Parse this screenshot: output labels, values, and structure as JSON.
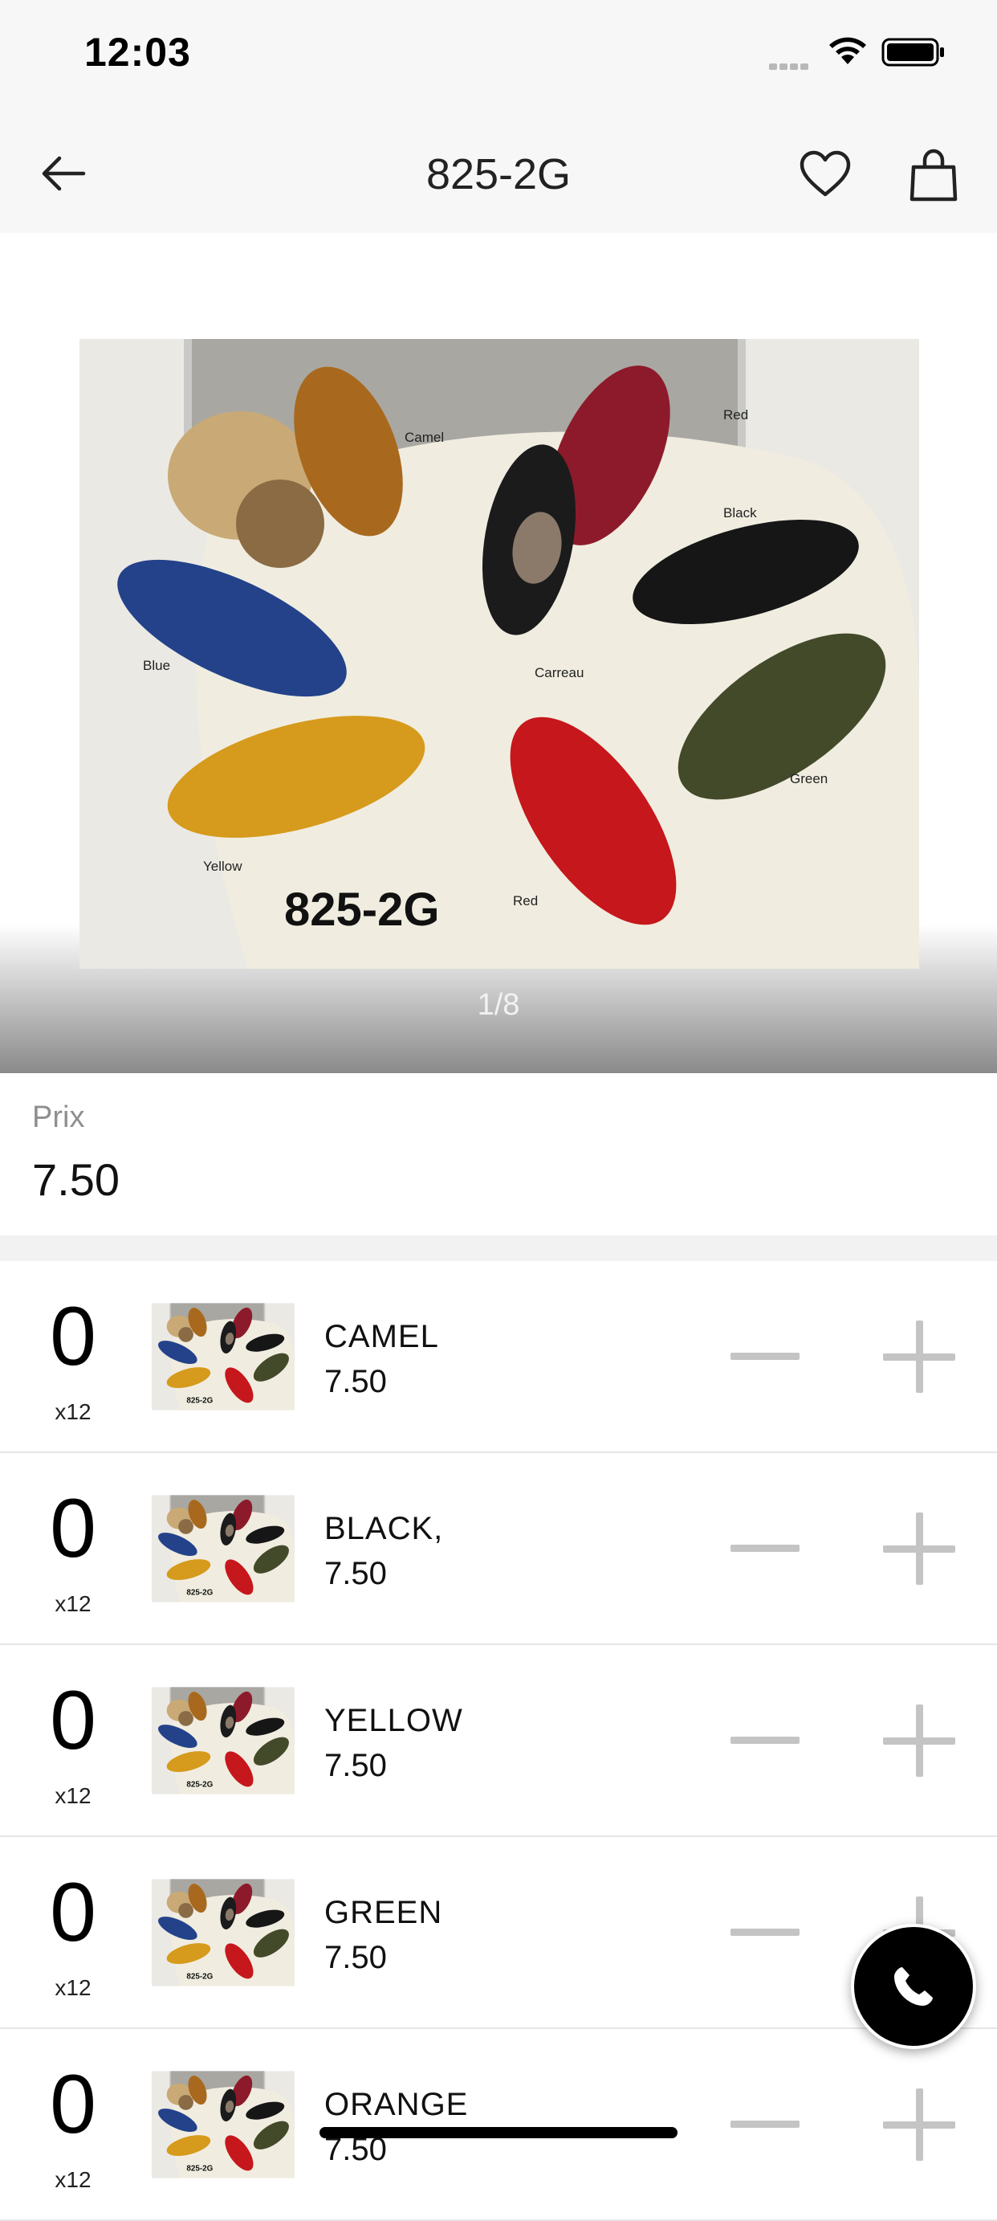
{
  "status_bar": {
    "time": "12:03"
  },
  "nav": {
    "title": "825-2G"
  },
  "gallery": {
    "page_indicator": "1/8",
    "current_page": 1,
    "total_pages": 8
  },
  "product": {
    "price_label": "Prix",
    "price": "7.50"
  },
  "variants": [
    {
      "quantity": "0",
      "multiplier": "x12",
      "name": "CAMEL",
      "price": "7.50"
    },
    {
      "quantity": "0",
      "multiplier": "x12",
      "name": "BLACK,",
      "price": "7.50"
    },
    {
      "quantity": "0",
      "multiplier": "x12",
      "name": "YELLOW",
      "price": "7.50"
    },
    {
      "quantity": "0",
      "multiplier": "x12",
      "name": "GREEN",
      "price": "7.50"
    },
    {
      "quantity": "0",
      "multiplier": "x12",
      "name": "ORANGE",
      "price": "7.50"
    }
  ],
  "photo_labels": {
    "model": "825-2G",
    "colors": [
      "Camel",
      "Red",
      "Black",
      "Blue",
      "Carreau",
      "Green",
      "Yellow",
      "Red"
    ]
  },
  "icons": {
    "back": "arrow-left-icon",
    "favorite": "heart-icon",
    "cart": "shopping-bag-icon",
    "call": "phone-icon",
    "decrement": "minus-icon",
    "increment": "plus-icon"
  },
  "colors": {
    "bar_background": "#f7f7f7",
    "stepper": "#c4c4c4",
    "fab": "#000000",
    "separator": "#f2f2f2"
  }
}
